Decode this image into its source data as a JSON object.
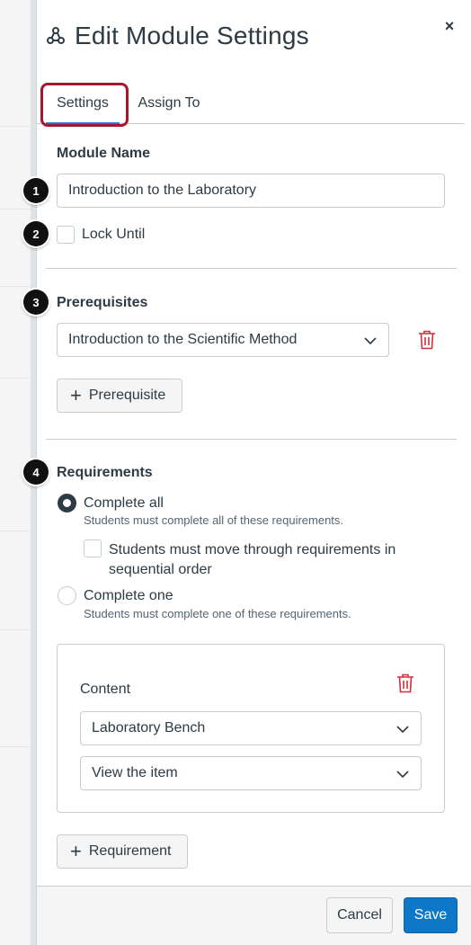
{
  "header": {
    "title": "Edit Module Settings",
    "close_icon": "×"
  },
  "tabs": [
    {
      "label": "Settings",
      "active": true
    },
    {
      "label": "Assign To",
      "active": false
    }
  ],
  "module_name": {
    "label": "Module Name",
    "value": "Introduction to the Laboratory"
  },
  "lock_until": {
    "label": "Lock Until",
    "checked": false
  },
  "prerequisites": {
    "label": "Prerequisites",
    "selected": "Introduction to the Scientific Method",
    "add_label": "Prerequisite"
  },
  "requirements": {
    "label": "Requirements",
    "complete_all": {
      "label": "Complete all",
      "help": "Students must complete all of these requirements.",
      "selected": true
    },
    "sequential": {
      "line1": "Students must move through requirements in",
      "line2": "sequential order",
      "checked": false
    },
    "complete_one": {
      "label": "Complete one",
      "help": "Students must complete one of these requirements.",
      "selected": false
    },
    "content": {
      "label": "Content",
      "item": "Laboratory Bench",
      "action": "View the item"
    },
    "add_label": "Requirement"
  },
  "footer": {
    "cancel": "Cancel",
    "save": "Save"
  },
  "callouts": [
    "1",
    "2",
    "3",
    "4"
  ],
  "colors": {
    "accent": "#2b7abc",
    "save": "#0e78c8",
    "danger": "#d0303b",
    "highlight": "#a3182c"
  }
}
